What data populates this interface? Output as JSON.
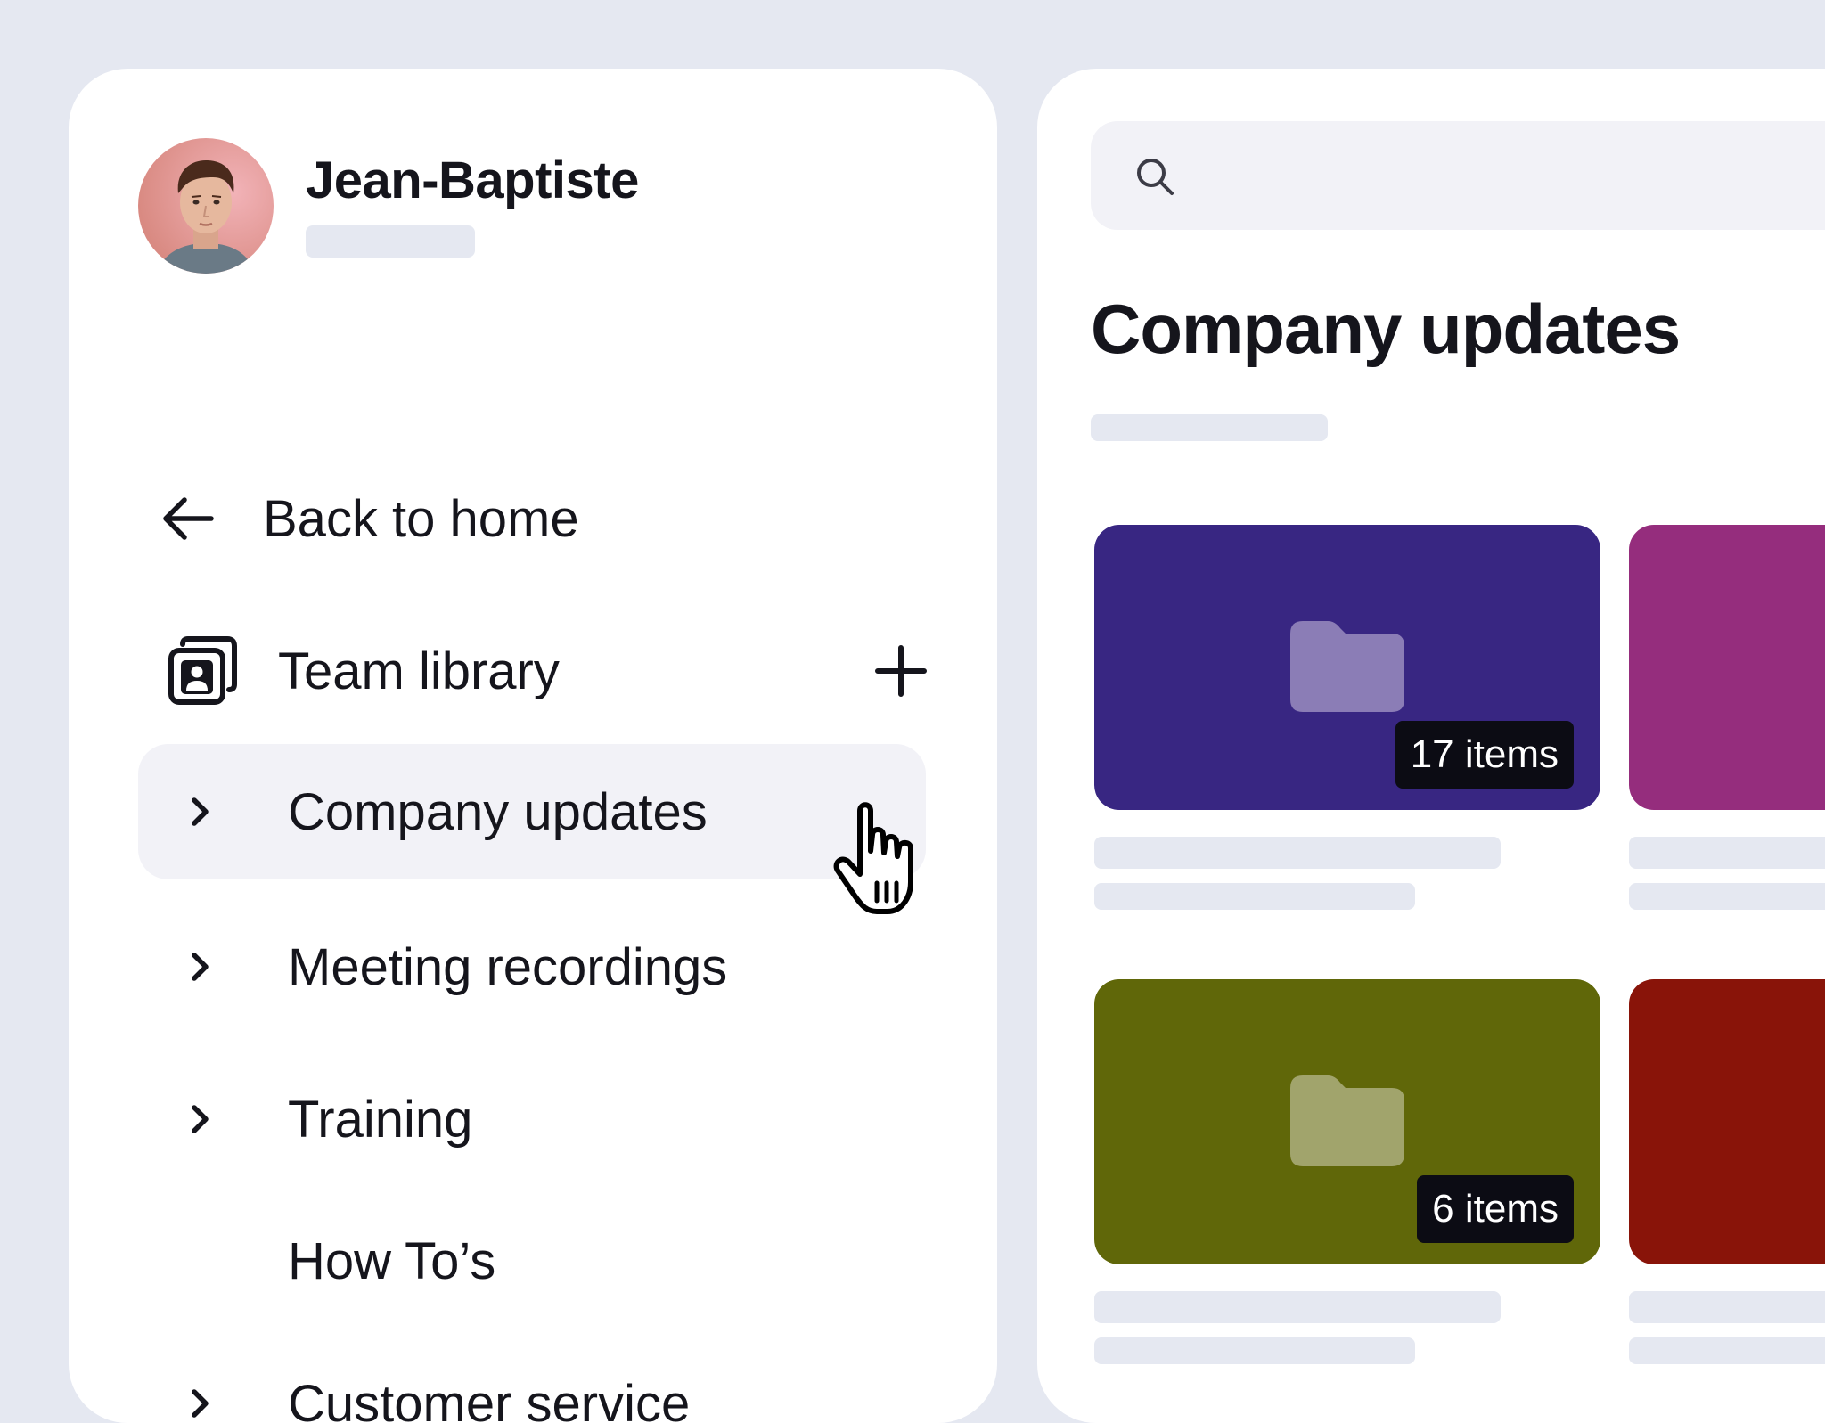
{
  "user": {
    "name": "Jean-Baptiste"
  },
  "sidebar": {
    "back_label": "Back to home",
    "team_library_label": "Team library",
    "items": [
      {
        "label": "Company updates",
        "chevron": true,
        "active": true
      },
      {
        "label": "Meeting recordings",
        "chevron": true,
        "active": false
      },
      {
        "label": "Training",
        "chevron": true,
        "active": false
      },
      {
        "label": "How To’s",
        "chevron": false,
        "active": false
      },
      {
        "label": "Customer service",
        "chevron": true,
        "active": false
      }
    ]
  },
  "main": {
    "title": "Company updates",
    "cards": [
      {
        "color": "#382682",
        "folder_color": "#8b7db6",
        "badge": "17 items"
      },
      {
        "color": "#952d7d",
        "folder_color": null,
        "badge": null
      },
      {
        "color": "#606709",
        "folder_color": "#a1a46c",
        "badge": "6 items"
      },
      {
        "color": "#891409",
        "folder_color": null,
        "badge": null
      }
    ]
  },
  "colors": {
    "background": "#e5e8f1",
    "panel": "#ffffff",
    "active_item": "#f2f2f7",
    "placeholder": "#e5e8f1",
    "text": "#15151c"
  },
  "icons": {
    "back": "arrow-left-icon",
    "team_library": "team-library-icon",
    "add": "plus-icon",
    "chevron": "chevron-right-icon",
    "search": "search-icon",
    "folder": "folder-icon",
    "cursor": "hand-pointer-cursor"
  }
}
